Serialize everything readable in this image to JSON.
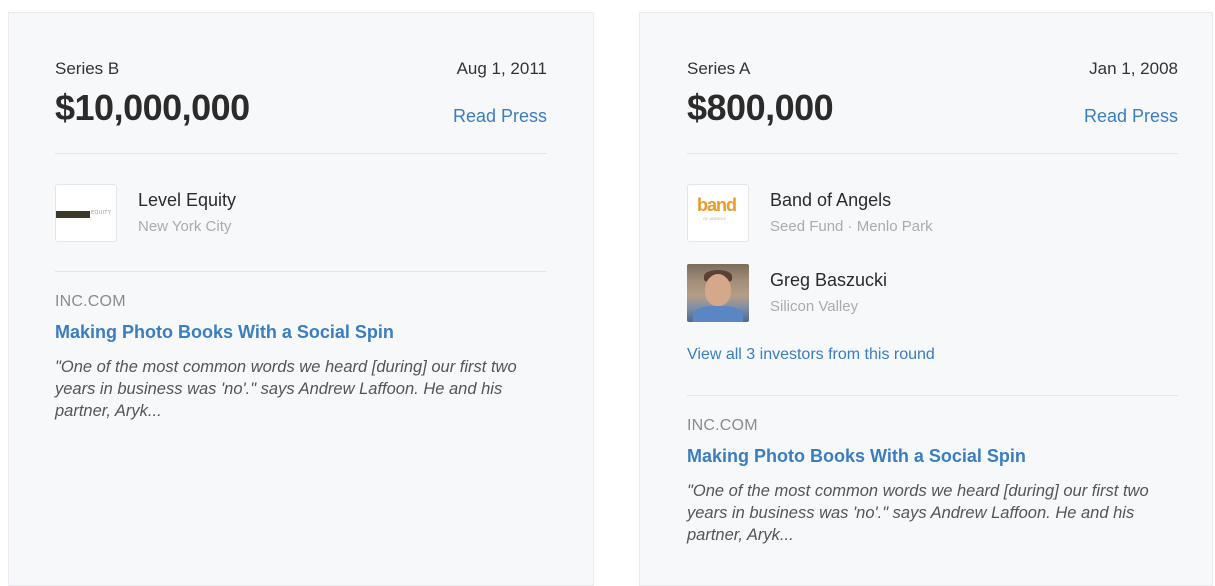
{
  "cards": [
    {
      "round": "Series B",
      "date": "Aug 1, 2011",
      "amount": "$10,000,000",
      "read_press": "Read Press",
      "investors": [
        {
          "name": "Level Equity",
          "sub": "New York City",
          "logo": "level-equity-logo",
          "logo_text_dark": "LEVEL",
          "logo_text_light": "EQUITY"
        }
      ],
      "press": {
        "source": "INC.COM",
        "headline": "Making Photo Books With a Social Spin",
        "excerpt": "\"One of the most common words we heard [during] our first two years in business was 'no'.\" says Andrew Laffoon. He and his partner, Aryk..."
      }
    },
    {
      "round": "Series A",
      "date": "Jan 1, 2008",
      "amount": "$800,000",
      "read_press": "Read Press",
      "investors": [
        {
          "name": "Band of Angels",
          "sub": "Seed Fund · Menlo Park",
          "logo": "band-of-angels-logo",
          "logo_word": "band",
          "logo_tiny": "OF ANGELS"
        },
        {
          "name": "Greg Baszucki",
          "sub": "Silicon Valley",
          "logo": "person-avatar"
        }
      ],
      "view_all": "View all 3 investors from this round",
      "press": {
        "source": "INC.COM",
        "headline": "Making Photo Books With a Social Spin",
        "excerpt": "\"One of the most common words we heard [during] our first two years in business was 'no'.\" says Andrew Laffoon. He and his partner, Aryk..."
      }
    }
  ],
  "colors": {
    "link": "#3a7dc0",
    "card_bg": "#f7f8fa",
    "band_logo": "#e99a2c"
  }
}
